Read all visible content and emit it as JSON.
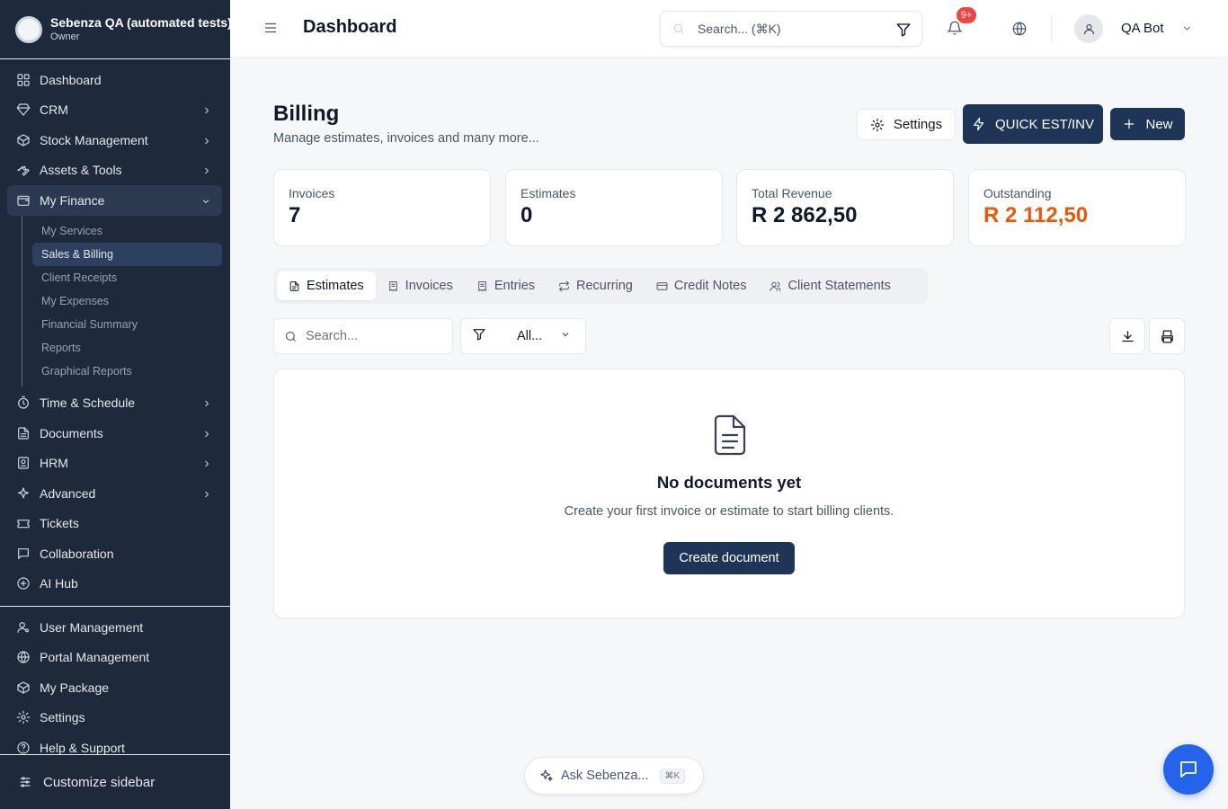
{
  "org": {
    "name": "Sebenza QA (automated tests)",
    "role": "Owner"
  },
  "sidebar": {
    "items": [
      {
        "label": "Dashboard",
        "icon": "dashboard-icon"
      },
      {
        "label": "CRM",
        "icon": "diamond-icon"
      },
      {
        "label": "Stock Management",
        "icon": "box-icon"
      },
      {
        "label": "Assets & Tools",
        "icon": "wrench-icon"
      },
      {
        "label": "My Finance",
        "icon": "wallet-icon"
      },
      {
        "label": "Time & Schedule",
        "icon": "timer-icon"
      },
      {
        "label": "Documents",
        "icon": "file-icon"
      },
      {
        "label": "HRM",
        "icon": "id-badge-icon"
      },
      {
        "label": "Advanced",
        "icon": "sparkle-icon"
      },
      {
        "label": "Tickets",
        "icon": "ticket-icon"
      },
      {
        "label": "Collaboration",
        "icon": "chat-icon"
      },
      {
        "label": "AI Hub",
        "icon": "ai-icon"
      }
    ],
    "finance_sub": [
      "My Services",
      "Sales & Billing",
      "Client Receipts",
      "My Expenses",
      "Financial Summary",
      "Reports",
      "Graphical Reports"
    ],
    "bottom": [
      {
        "label": "User Management",
        "icon": "user-cog-icon"
      },
      {
        "label": "Portal Management",
        "icon": "globe-icon"
      },
      {
        "label": "My Package",
        "icon": "package-icon"
      },
      {
        "label": "Settings",
        "icon": "gear-icon"
      },
      {
        "label": "Help & Support",
        "icon": "help-icon"
      }
    ],
    "customize_label": "Customize sidebar"
  },
  "header": {
    "title": "Dashboard",
    "search_placeholder": "Search... (⌘K)",
    "notif_count": "9+",
    "user_name": "QA Bot"
  },
  "billing": {
    "title": "Billing",
    "subtitle": "Manage estimates, invoices and many more...",
    "settings_label": "Settings",
    "quick_label": "QUICK EST/INV",
    "new_label": "New"
  },
  "stats": [
    {
      "label": "Invoices",
      "value": "7",
      "color": "#111827"
    },
    {
      "label": "Estimates",
      "value": "0",
      "color": "#111827"
    },
    {
      "label": "Total Revenue",
      "value": "R 2 862,50",
      "color": "#111827"
    },
    {
      "label": "Outstanding",
      "value": "R 2 112,50",
      "color": "#ea580c"
    }
  ],
  "tabs": [
    "Estimates",
    "Invoices",
    "Entries",
    "Recurring",
    "Credit Notes",
    "Client Statements"
  ],
  "list": {
    "search_placeholder": "Search...",
    "filter_value": "All..."
  },
  "empty": {
    "title": "No documents yet",
    "subtitle": "Create your first invoice or estimate to start billing clients.",
    "button": "Create document"
  },
  "ask": {
    "label": "Ask Sebenza...",
    "shortcut": "⌘K"
  },
  "colors": {
    "sidebar_bg": "#1e2a3b",
    "primary": "#1e3558",
    "accent_blue": "#2563eb",
    "outstanding": "#ea580c",
    "badge": "#ef4444"
  }
}
